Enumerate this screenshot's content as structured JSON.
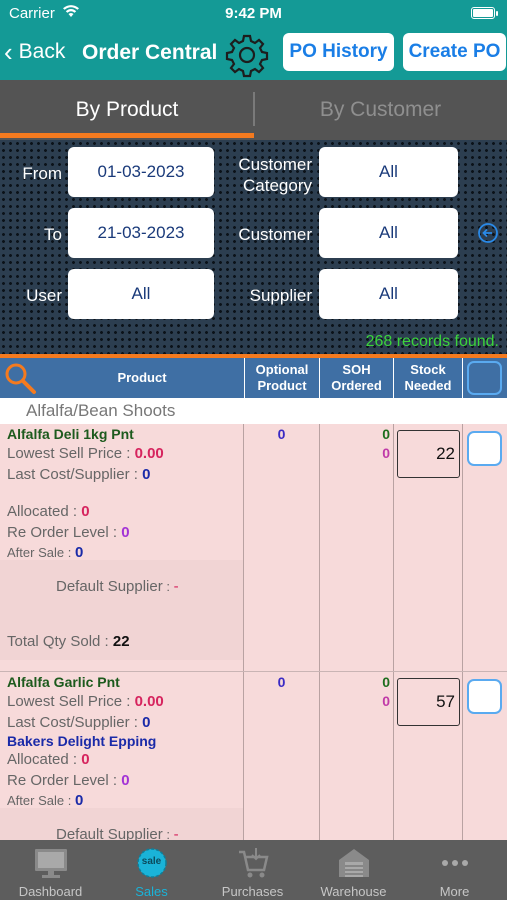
{
  "status": {
    "carrier": "Carrier",
    "time": "9:42 PM"
  },
  "nav": {
    "back": "Back",
    "title": "Order Central",
    "po_history": "PO History",
    "create_po": "Create PO"
  },
  "segments": {
    "by_product": "By Product",
    "by_customer": "By Customer",
    "active": "By Product"
  },
  "filters": {
    "from_label": "From",
    "from_value": "01-03-2023",
    "to_label": "To",
    "to_value": "21-03-2023",
    "user_label": "User",
    "user_value": "All",
    "customer_category_label_1": "Customer",
    "customer_category_label_2": "Category",
    "customer_category_value": "All",
    "customer_label": "Customer",
    "customer_value": "All",
    "supplier_label": "Supplier",
    "supplier_value": "All",
    "records": "268 records found."
  },
  "table": {
    "headers": {
      "product": "Product",
      "optional_1": "Optional",
      "optional_2": "Product",
      "soh_1": "SOH",
      "soh_2": "Ordered",
      "stock_1": "Stock",
      "stock_2": "Needed"
    },
    "group": "Alfalfa/Bean Shoots",
    "rows": [
      {
        "name": "Alfalfa Deli 1kg Pnt",
        "lowest_sell_label": "Lowest Sell Price",
        "lowest_sell": "0.00",
        "last_cost_label": "Last Cost/Supplier",
        "last_cost": "0",
        "supplier": "",
        "allocated_label": "Allocated",
        "allocated": "0",
        "reorder_label": "Re Order Level",
        "reorder": "0",
        "after_sale_label": "After Sale",
        "after_sale": "0",
        "default_supplier_label": "Default Supplier",
        "default_supplier": "-",
        "total_qty_label": "Total Qty Sold",
        "total_qty": "22",
        "optional": "0",
        "soh": "0",
        "ordered": "0",
        "stock_needed": "22"
      },
      {
        "name": "Alfalfa Garlic Pnt",
        "lowest_sell_label": "Lowest Sell Price",
        "lowest_sell": "0.00",
        "last_cost_label": "Last Cost/Supplier",
        "last_cost": "0",
        "supplier": "Bakers Delight Epping",
        "allocated_label": "Allocated",
        "allocated": "0",
        "reorder_label": "Re Order Level",
        "reorder": "0",
        "after_sale_label": "After Sale",
        "after_sale": "0",
        "default_supplier_label": "Default Supplier",
        "default_supplier": "-",
        "optional": "0",
        "soh": "0",
        "ordered": "0",
        "stock_needed": "57"
      }
    ]
  },
  "tabs": [
    {
      "label": "Dashboard",
      "icon": "monitor-icon"
    },
    {
      "label": "Sales",
      "icon": "sale-icon",
      "active": true,
      "badge": "sale"
    },
    {
      "label": "Purchases",
      "icon": "cart-icon"
    },
    {
      "label": "Warehouse",
      "icon": "warehouse-icon"
    },
    {
      "label": "More",
      "icon": "more-dots-icon"
    }
  ],
  "colors": {
    "teal": "#149a96",
    "accent": "#f47a1f",
    "table_header": "#3f6fa4",
    "row_bg": "#f7dada",
    "records_green": "#3bd43b",
    "tab_active": "#1ab3d8"
  }
}
